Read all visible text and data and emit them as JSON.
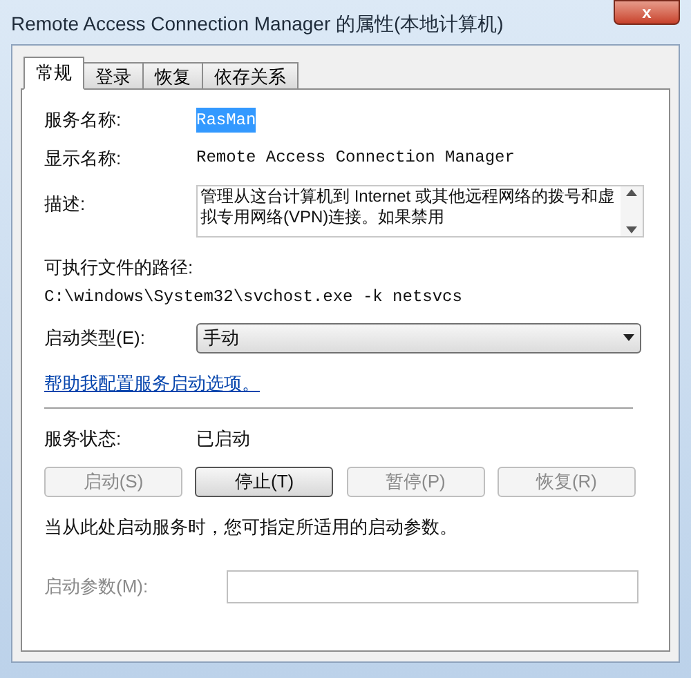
{
  "window": {
    "title": "Remote Access Connection Manager 的属性(本地计算机)",
    "close_icon": "x"
  },
  "tabs": [
    {
      "label": "常规",
      "selected": true
    },
    {
      "label": "登录",
      "selected": false
    },
    {
      "label": "恢复",
      "selected": false
    },
    {
      "label": "依存关系",
      "selected": false
    }
  ],
  "fields": [
    {
      "label": "服务名称:",
      "value": "RasMan",
      "selected": true
    },
    {
      "label": "显示名称:",
      "value": "Remote Access Connection Manager",
      "selected": false
    }
  ],
  "description": {
    "label": "描述:",
    "value": "管理从这台计算机到 Internet 或其他远程网络的拨号和虚拟专用网络(VPN)连接。如果禁用"
  },
  "path": {
    "label": "可执行文件的路径:",
    "value": "C:\\windows\\System32\\svchost.exe -k netsvcs"
  },
  "startup_type": {
    "label": "启动类型(E):",
    "value": "手动"
  },
  "help_link": "帮助我配置服务启动选项。",
  "service_status": {
    "label": "服务状态:",
    "value": "已启动"
  },
  "buttons": [
    {
      "label": "启动(S)",
      "disabled": true
    },
    {
      "label": "停止(T)",
      "disabled": false
    },
    {
      "label": "暂停(P)",
      "disabled": true
    },
    {
      "label": "恢复(R)",
      "disabled": true
    }
  ],
  "note": "当从此处启动服务时，您可指定所适用的启动参数。",
  "start_params": {
    "label": "启动参数(M):",
    "disabled": true
  }
}
